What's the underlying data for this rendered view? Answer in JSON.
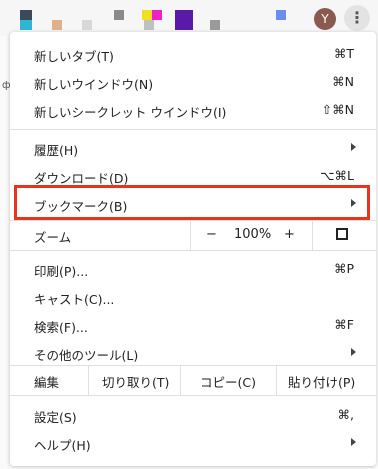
{
  "browser": {
    "avatar_letter": "Y",
    "tab_fragment": "фо"
  },
  "menu": {
    "items": [
      {
        "label": "新しいタブ(T)",
        "shortcut": "⌘T"
      },
      {
        "label": "新しいウインドウ(N)",
        "shortcut": "⌘N"
      },
      {
        "label": "新しいシークレット ウインドウ(I)",
        "shortcut": "⇧⌘N"
      },
      {
        "label": "履歴(H)"
      },
      {
        "label": "ダウンロード(D)",
        "shortcut": "⌥⌘L"
      },
      {
        "label": "ブックマーク(B)"
      }
    ],
    "zoom": {
      "label": "ズーム",
      "minus": "−",
      "value": "100%",
      "plus": "+"
    },
    "items2": [
      {
        "label": "印刷(P)...",
        "shortcut": "⌘P"
      },
      {
        "label": "キャスト(C)..."
      },
      {
        "label": "検索(F)...",
        "shortcut": "⌘F"
      },
      {
        "label": "その他のツール(L)"
      }
    ],
    "edit": {
      "label": "編集",
      "cut": "切り取り(T)",
      "copy": "コピー(C)",
      "paste": "貼り付け(P)"
    },
    "items3": [
      {
        "label": "設定(S)",
        "shortcut": "⌘,"
      },
      {
        "label": "ヘルプ(H)"
      }
    ]
  },
  "colors": {
    "highlight": "#e8341c"
  }
}
